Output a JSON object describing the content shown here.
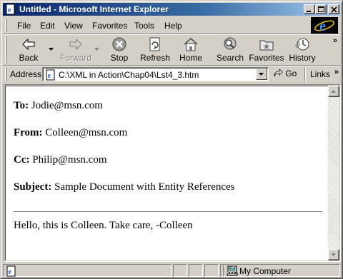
{
  "window": {
    "title": "Untitled - Microsoft Internet Explorer"
  },
  "menu": {
    "items": [
      "File",
      "Edit",
      "View",
      "Favorites",
      "Tools",
      "Help"
    ]
  },
  "toolbar": {
    "back": "Back",
    "forward": "Forward",
    "stop": "Stop",
    "refresh": "Refresh",
    "home": "Home",
    "search": "Search",
    "favorites": "Favorites",
    "history": "History"
  },
  "address": {
    "label": "Address",
    "url": "C:\\XML in Action\\Chap04\\Lst4_3.htm",
    "go": "Go",
    "links": "Links"
  },
  "document": {
    "to_label": "To:",
    "to_value": "Jodie@msn.com",
    "from_label": "From:",
    "from_value": "Colleen@msn.com",
    "cc_label": "Cc:",
    "cc_value": "Philip@msn.com",
    "subject_label": "Subject:",
    "subject_value": "Sample Document with Entity References",
    "body": "Hello, this is Colleen. Take care, -Colleen"
  },
  "status": {
    "zone": "My Computer"
  },
  "colors": {
    "titlebar_start": "#0a246a",
    "titlebar_end": "#a6caf0",
    "chrome": "#d4d0c8"
  }
}
